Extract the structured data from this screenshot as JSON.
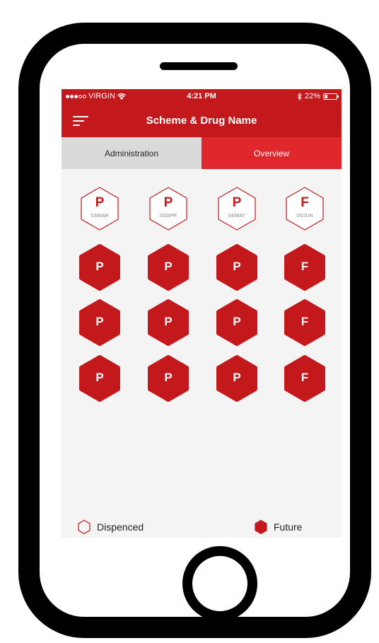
{
  "status_bar": {
    "carrier": "VIRGIN",
    "wifi_icon": "wifi-icon",
    "time": "4:21 PM",
    "bluetooth_icon": "bluetooth-icon",
    "battery_percent": "22%",
    "battery_level": 0.22
  },
  "nav": {
    "title": "Scheme & Drug Name",
    "menu_icon": "menu-icon"
  },
  "tabs": [
    {
      "label": "Administration",
      "selected": false
    },
    {
      "label": "Overview",
      "selected": true
    }
  ],
  "grid": {
    "rows": [
      [
        {
          "letter": "P",
          "date": "03/MAR",
          "style": "outline"
        },
        {
          "letter": "P",
          "date": "03/APR",
          "style": "outline"
        },
        {
          "letter": "P",
          "date": "04/MAY",
          "style": "outline"
        },
        {
          "letter": "F",
          "date": "05/JUN",
          "style": "outline"
        }
      ],
      [
        {
          "letter": "P",
          "style": "filled"
        },
        {
          "letter": "P",
          "style": "filled"
        },
        {
          "letter": "P",
          "style": "filled"
        },
        {
          "letter": "F",
          "style": "filled"
        }
      ],
      [
        {
          "letter": "P",
          "style": "filled"
        },
        {
          "letter": "P",
          "style": "filled"
        },
        {
          "letter": "P",
          "style": "filled"
        },
        {
          "letter": "F",
          "style": "filled"
        }
      ],
      [
        {
          "letter": "P",
          "style": "filled"
        },
        {
          "letter": "P",
          "style": "filled"
        },
        {
          "letter": "P",
          "style": "filled"
        },
        {
          "letter": "F",
          "style": "filled"
        }
      ]
    ]
  },
  "legend": {
    "dispensed_label": "Dispenced",
    "future_label": "Future"
  },
  "colors": {
    "brand_red": "#c4191c",
    "tab_active_red": "#e0272b",
    "tab_inactive_gray": "#dadada",
    "background": "#f4f4f4"
  }
}
